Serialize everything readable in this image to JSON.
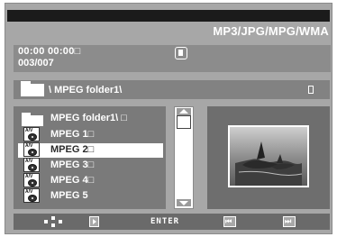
{
  "header": {
    "title": "MP3/JPG/MPG/WMA"
  },
  "info": {
    "time": "00:00  00:00□",
    "track_count": "003/007"
  },
  "path": {
    "label": "\\ MPEG folder1\\"
  },
  "file_list": {
    "items": [
      {
        "label": "MPEG folder1\\  □",
        "type": "folder",
        "selected": false
      },
      {
        "label": "MPEG 1□",
        "type": "file",
        "selected": false
      },
      {
        "label": "MPEG 2□",
        "type": "file",
        "selected": true
      },
      {
        "label": "MPEG 3□",
        "type": "file",
        "selected": false
      },
      {
        "label": "MPEG 4□",
        "type": "file",
        "selected": false
      },
      {
        "label": "MPEG 5",
        "type": "file",
        "selected": false
      }
    ]
  },
  "icons": {
    "stop": "stop-icon",
    "folder": "folder-icon",
    "file": "av-disc-icon",
    "navigate": "navigate-arrows-icon",
    "play": "play-icon",
    "prev": "skip-previous-icon",
    "next": "skip-next-icon",
    "preview": "dolphins-thumbnail"
  },
  "footer": {
    "enter_label": "ENTER"
  },
  "colors": {
    "panel": "#a7a7a7",
    "title_bar": "#1b1b1b",
    "highlight": "#ffffff",
    "text": "#ffffff"
  }
}
